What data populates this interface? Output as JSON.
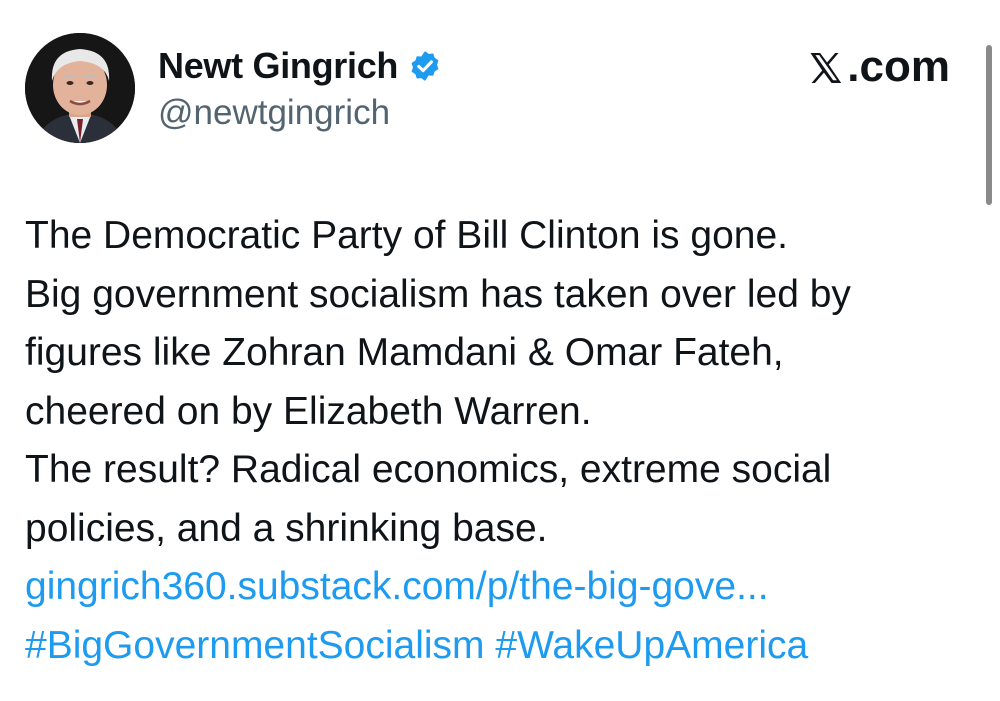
{
  "author": {
    "display_name": "Newt Gingrich",
    "handle": "@newtgingrich",
    "verified": true,
    "verified_badge_color": "#1d9bf0",
    "avatar_icon": "profile-photo"
  },
  "brand": {
    "logo_icon": "x-logo-icon",
    "suffix": ".com"
  },
  "tweet": {
    "lines": [
      "The Democratic Party of Bill Clinton is gone.",
      "Big government socialism has taken over led by",
      "figures like Zohran Mamdani & Omar Fateh,",
      "cheered on by Elizabeth Warren.",
      "The result? Radical economics, extreme social",
      "policies, and a shrinking base."
    ],
    "link_url": "gingrich360.substack.com/p/the-big-gove...",
    "hashtags": [
      "#BigGovernmentSocialism",
      "#WakeUpAmerica"
    ],
    "link_color": "#1d9bf0"
  }
}
